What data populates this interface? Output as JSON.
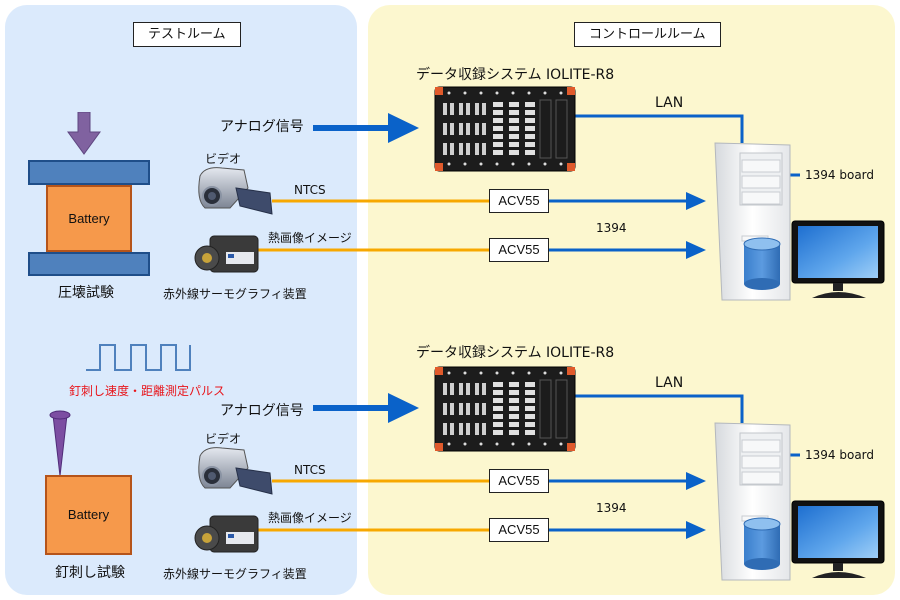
{
  "rooms": {
    "test_room": "テストルーム",
    "control_room": "コントロールルーム"
  },
  "colors": {
    "test_room_bg": "#dbeafc",
    "control_room_bg": "#fcf7cf",
    "blue_line": "#0a62c9",
    "orange_line": "#f7a800",
    "battery": "#f6994b",
    "plate": "#4f81bd",
    "arrow_purple": "#8062a0",
    "pulse": "#4f81bd",
    "pulse_label": "#e8151b"
  },
  "setups": [
    {
      "test_name": "圧壊試験",
      "battery_label": "Battery",
      "actuator": "press-arrow",
      "analog_signal_label": "アナログ信号",
      "video_label": "ビデオ",
      "ntcs_label": "NTCS",
      "thermal_label": "熱画像イメージ",
      "thermal_device_label": "赤外線サーモグラフィ装置",
      "daq_title": "データ収録システム IOLITE-R8",
      "lan_label": "LAN",
      "converter_1": "ACV55",
      "converter_2": "ACV55",
      "link_label": "1394",
      "board_label": "1394 board"
    },
    {
      "test_name": "釘刺し試験",
      "battery_label": "Battery",
      "actuator": "nail",
      "pulse_label": "釘刺し速度・距離測定パルス",
      "analog_signal_label": "アナログ信号",
      "video_label": "ビデオ",
      "ntcs_label": "NTCS",
      "thermal_label": "熱画像イメージ",
      "thermal_device_label": "赤外線サーモグラフィ装置",
      "daq_title": "データ収録システム IOLITE-R8",
      "lan_label": "LAN",
      "converter_1": "ACV55",
      "converter_2": "ACV55",
      "link_label": "1394",
      "board_label": "1394 board"
    }
  ]
}
